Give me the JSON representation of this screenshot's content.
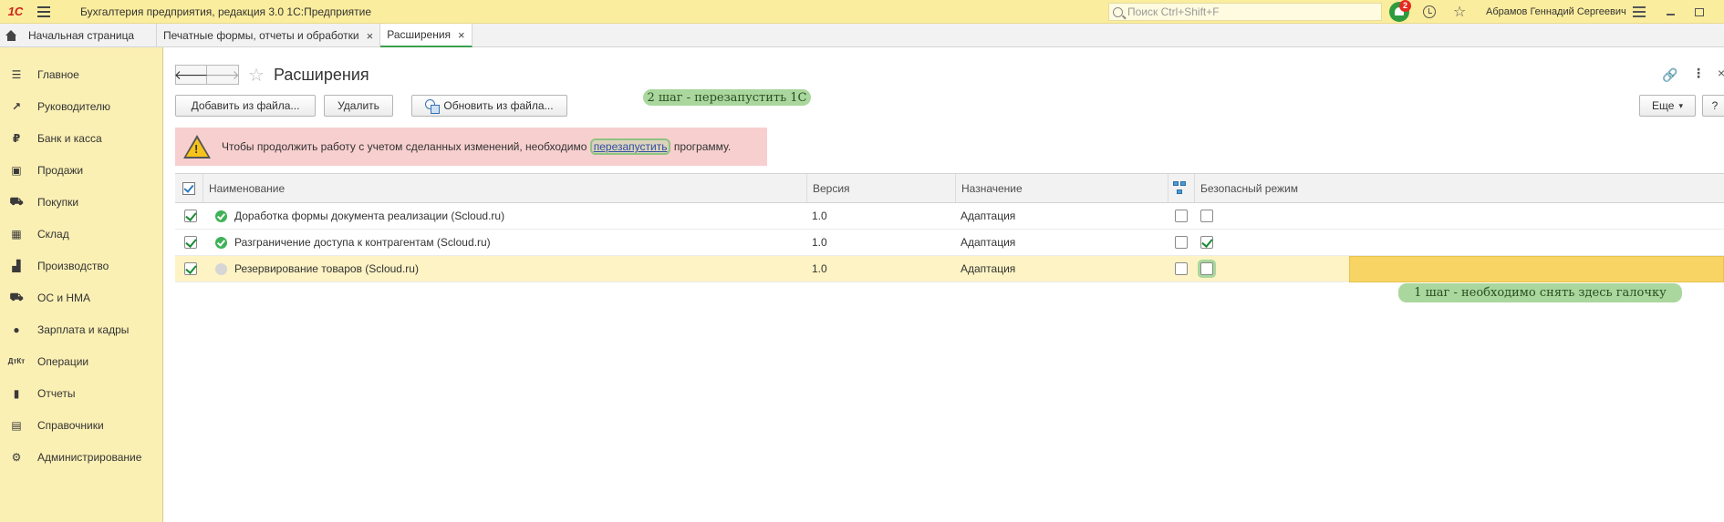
{
  "titlebar": {
    "logo": "1С",
    "title": "Бухгалтерия предприятия, редакция 3.0 1С:Предприятие",
    "search_placeholder": "Поиск Ctrl+Shift+F",
    "notifications_count": "2",
    "user": "Абрамов Геннадий Сергеевич"
  },
  "tabs": [
    {
      "label": "Начальная страница"
    },
    {
      "label": "Печатные формы, отчеты и обработки",
      "close": "×"
    },
    {
      "label": "Расширения",
      "close": "×"
    }
  ],
  "sidebar": {
    "items": [
      {
        "label": "Главное",
        "icon": "menu-icon"
      },
      {
        "label": "Руководителю",
        "icon": "trend-icon"
      },
      {
        "label": "Банк и касса",
        "icon": "ruble-icon"
      },
      {
        "label": "Продажи",
        "icon": "bag-icon"
      },
      {
        "label": "Покупки",
        "icon": "cart-icon"
      },
      {
        "label": "Склад",
        "icon": "warehouse-icon"
      },
      {
        "label": "Производство",
        "icon": "factory-icon"
      },
      {
        "label": "ОС и НМА",
        "icon": "truck-icon"
      },
      {
        "label": "Зарплата и кадры",
        "icon": "person-icon"
      },
      {
        "label": "Операции",
        "icon": "dt-kt-icon"
      },
      {
        "label": "Отчеты",
        "icon": "bar-chart-icon"
      },
      {
        "label": "Справочники",
        "icon": "books-icon"
      },
      {
        "label": "Администрирование",
        "icon": "gear-icon"
      }
    ]
  },
  "page": {
    "title": "Расширения",
    "back": "🡐",
    "forward": "🡒"
  },
  "toolbar": {
    "add_from_file": "Добавить из файла...",
    "delete": "Удалить",
    "update_from_file": "Обновить из файла...",
    "more": "Еще",
    "more_arrow": "▾",
    "help": "?"
  },
  "callouts": {
    "step2": "2 шаг - перезапустить 1С",
    "step1": "1 шаг - необходимо снять здесь галочку"
  },
  "warning": {
    "text_before": "Чтобы продолжить работу с учетом сделанных изменений, необходимо ",
    "link": "перезапустить",
    "text_after": " программу."
  },
  "table": {
    "headers": {
      "name": "Наименование",
      "version": "Версия",
      "purpose": "Назначение",
      "safe_mode": "Безопасный режим"
    },
    "rows": [
      {
        "name": "Доработка формы документа реализации (Scloud.ru)",
        "version": "1.0",
        "purpose": "Адаптация",
        "active": true,
        "status": "ok",
        "col5": false,
        "safe_mode": false,
        "selected": false
      },
      {
        "name": "Разграничение доступа к контрагентам (Scloud.ru)",
        "version": "1.0",
        "purpose": "Адаптация",
        "active": true,
        "status": "ok",
        "col5": false,
        "safe_mode": true,
        "selected": false
      },
      {
        "name": "Резервирование товаров (Scloud.ru)",
        "version": "1.0",
        "purpose": "Адаптация",
        "active": true,
        "status": "off",
        "col5": false,
        "safe_mode": false,
        "selected": true
      }
    ]
  }
}
